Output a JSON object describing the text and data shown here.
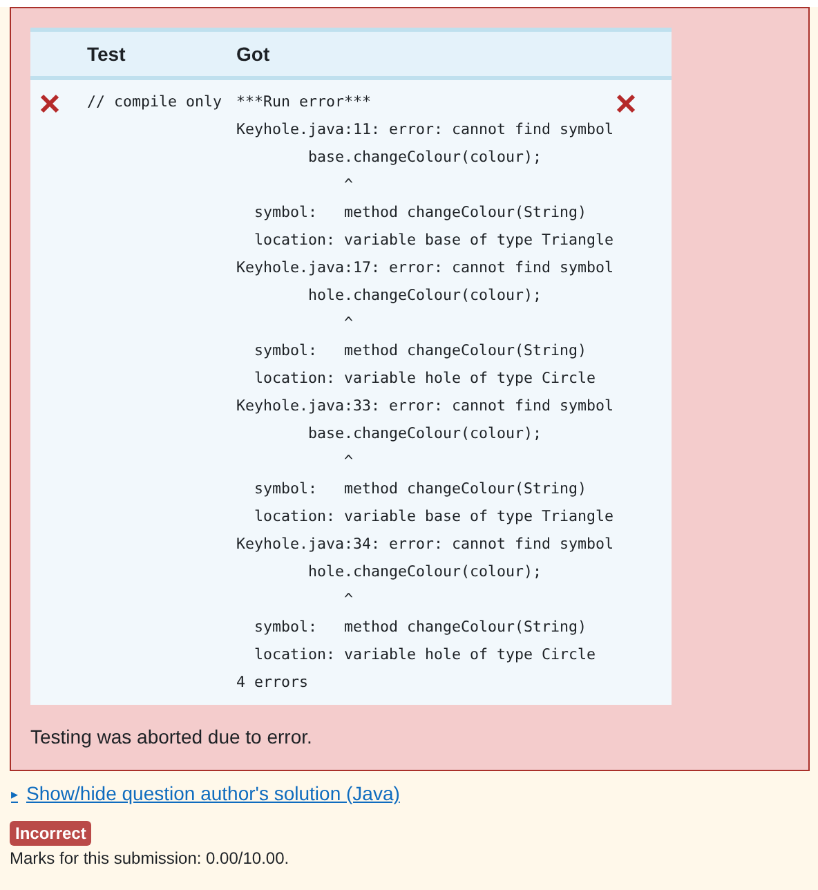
{
  "results_table": {
    "columns": [
      "Test",
      "Got"
    ],
    "rows": [
      {
        "correct": false,
        "test": "// compile only",
        "got": [
          "***Run error***",
          "Keyhole.java:11: error: cannot find symbol",
          "        base.changeColour(colour);",
          "            ^",
          "  symbol:   method changeColour(String)",
          "  location: variable base of type Triangle",
          "Keyhole.java:17: error: cannot find symbol",
          "        hole.changeColour(colour);",
          "            ^",
          "  symbol:   method changeColour(String)",
          "  location: variable hole of type Circle",
          "Keyhole.java:33: error: cannot find symbol",
          "        base.changeColour(colour);",
          "            ^",
          "  symbol:   method changeColour(String)",
          "  location: variable base of type Triangle",
          "Keyhole.java:34: error: cannot find symbol",
          "        hole.changeColour(colour);",
          "            ^",
          "  symbol:   method changeColour(String)",
          "  location: variable hole of type Circle",
          "4 errors"
        ]
      }
    ]
  },
  "message": "Testing was aborted due to error.",
  "solution_link": {
    "arrow": "▸",
    "label": "Show/hide question author's solution (Java)"
  },
  "grade_badge": "Incorrect",
  "marks": "Marks for this submission: 0.00/10.00."
}
